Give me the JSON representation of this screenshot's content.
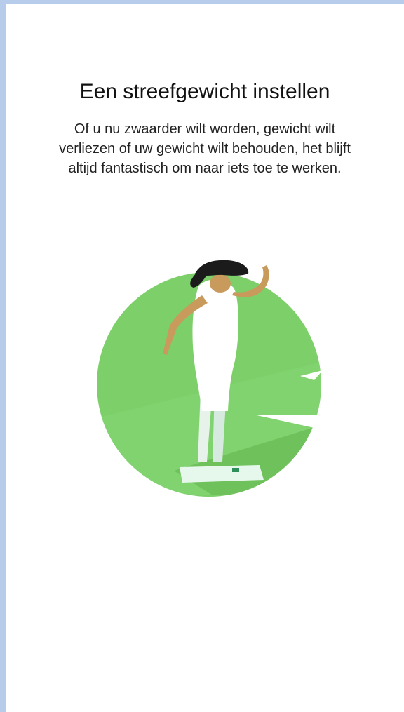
{
  "onboarding": {
    "title": "Een streefgewicht instellen",
    "description_lines": [
      "Of u nu zwaarder wilt worden, gewicht wilt",
      "verliezen of uw gewicht wilt behouden, het blijft",
      "altijd fantastisch om naar iets toe te werken."
    ]
  },
  "illustration": {
    "icon": "woman-on-scale-illustration",
    "colors": {
      "circle": "#7dcf6a",
      "hair": "#1b1b1b",
      "skin": "#c89a5c",
      "dress": "#ffffff",
      "scale": "#dff2e6"
    }
  }
}
